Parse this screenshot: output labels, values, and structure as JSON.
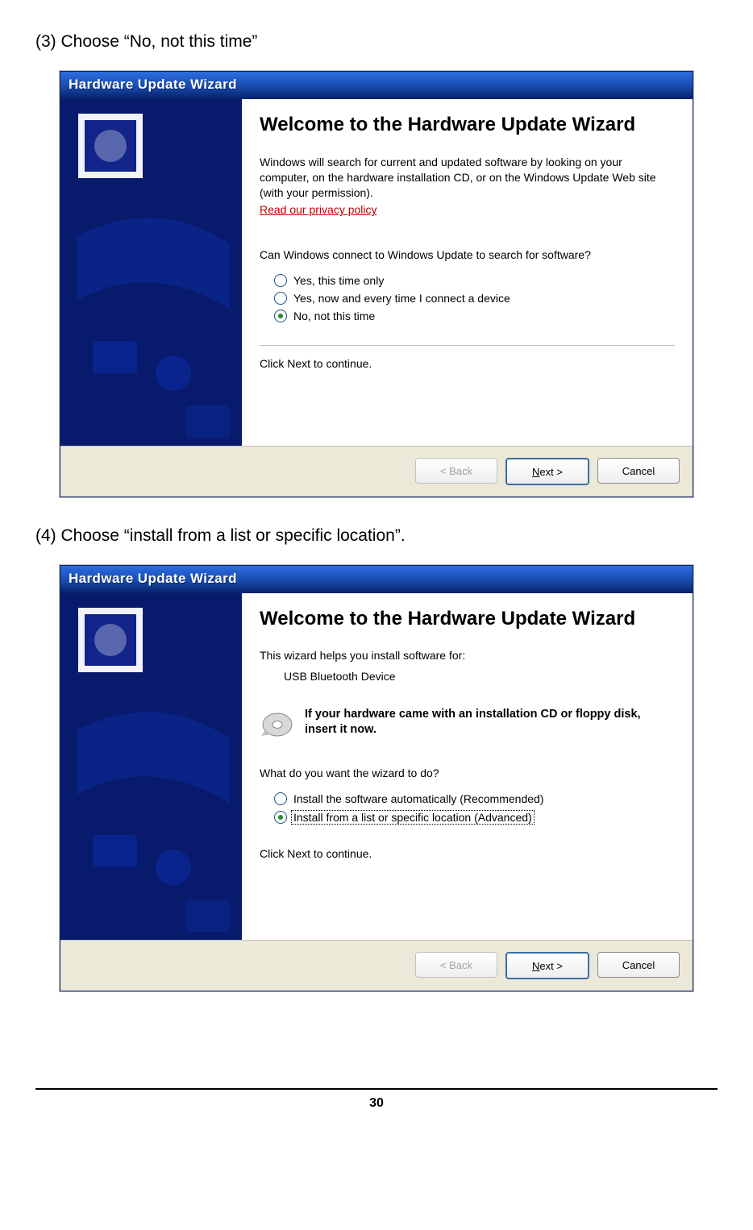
{
  "page": {
    "step3_instruction": "(3) Choose “No, not this time”",
    "step4_instruction": "(4) Choose “install from a list or specific location”.",
    "page_number": "30"
  },
  "dialog1": {
    "title": "Hardware Update Wizard",
    "heading": "Welcome to the Hardware Update Wizard",
    "description": "Windows will search for current and updated software by looking on your computer, on the hardware installation CD, or on the Windows Update Web site (with your permission).",
    "privacy_link": "Read our privacy policy",
    "question": "Can Windows connect to Windows Update to search for software?",
    "options": [
      {
        "label": "Yes, this time only",
        "selected": false
      },
      {
        "label": "Yes, now and every time I connect a device",
        "selected": false
      },
      {
        "label": "No, not this time",
        "selected": true
      }
    ],
    "continue_text": "Click Next to continue.",
    "buttons": {
      "back": "< Back",
      "next": "Next >",
      "cancel": "Cancel"
    }
  },
  "dialog2": {
    "title": "Hardware Update Wizard",
    "heading": "Welcome to the Hardware Update Wizard",
    "helps_text": "This wizard helps you install software for:",
    "device_name": "USB Bluetooth Device",
    "cd_hint": "If your hardware came with an installation CD or floppy disk, insert it now.",
    "question": "What do you want the wizard to do?",
    "options": [
      {
        "label": "Install the software automatically (Recommended)",
        "selected": false
      },
      {
        "label": "Install from a list or specific location (Advanced)",
        "selected": true
      }
    ],
    "continue_text": "Click Next to continue.",
    "buttons": {
      "back": "< Back",
      "next": "Next >",
      "cancel": "Cancel"
    }
  }
}
